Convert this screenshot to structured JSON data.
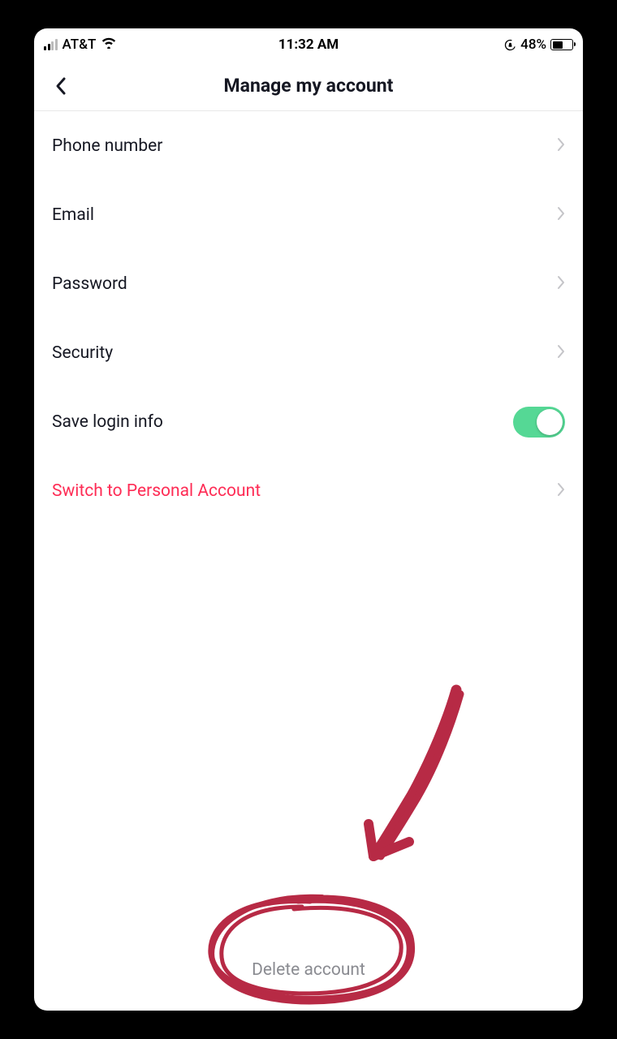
{
  "status_bar": {
    "carrier": "AT&T",
    "time": "11:32 AM",
    "battery_percent": "48%"
  },
  "header": {
    "title": "Manage my account"
  },
  "items": [
    {
      "label": "Phone number",
      "type": "nav"
    },
    {
      "label": "Email",
      "type": "nav"
    },
    {
      "label": "Password",
      "type": "nav"
    },
    {
      "label": "Security",
      "type": "nav"
    },
    {
      "label": "Save login info",
      "type": "toggle",
      "on": true
    },
    {
      "label": "Switch to Personal Account",
      "type": "nav",
      "accent": true
    }
  ],
  "footer": {
    "delete_label": "Delete account"
  },
  "annotation": {
    "type": "hand-drawn-circle-arrow",
    "color": "#b72a45",
    "target": "delete-account"
  }
}
